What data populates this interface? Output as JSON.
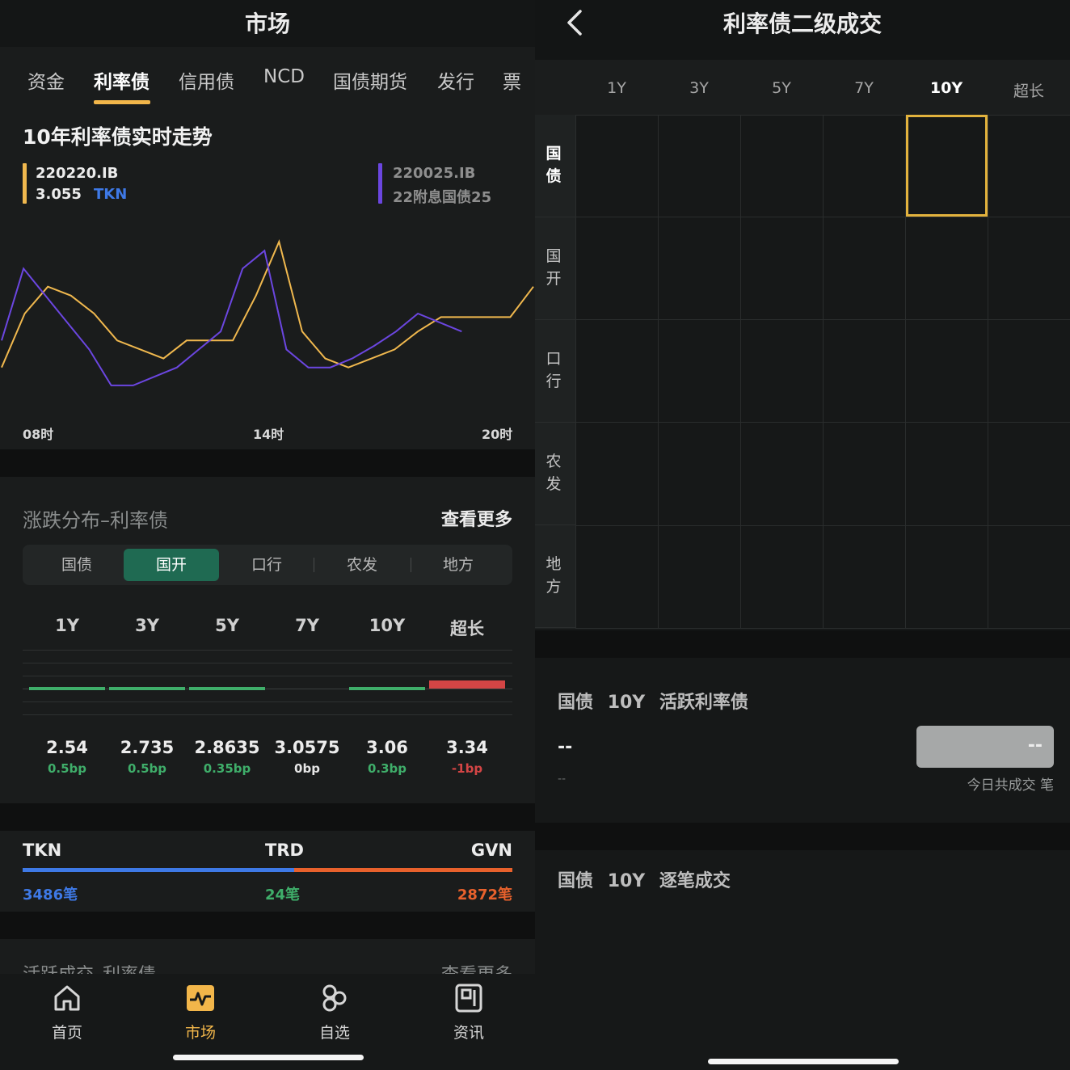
{
  "left": {
    "header_title": "市场",
    "tabs": [
      "资金",
      "利率债",
      "信用债",
      "NCD",
      "国债期货",
      "发行",
      "票"
    ],
    "chart": {
      "title": "10年利率债实时走势",
      "legend_a_code": "220220.IB",
      "legend_a_value": "3.055",
      "legend_a_source": "TKN",
      "legend_b_code": "220025.IB",
      "legend_b_name": "22附息国债25",
      "x_labels": [
        "08时",
        "14时",
        "20时"
      ]
    },
    "chart_data": {
      "type": "line",
      "title": "10年利率债实时走势",
      "x_ticks": [
        "08时",
        "14时",
        "20时"
      ],
      "series": [
        {
          "name": "220220.IB",
          "color": "#f0b84e",
          "values": [
            3.03,
            3.06,
            3.075,
            3.07,
            3.06,
            3.045,
            3.04,
            3.035,
            3.045,
            3.045,
            3.045,
            3.07,
            3.1,
            3.05,
            3.035,
            3.03,
            3.035,
            3.04,
            3.05,
            3.058,
            3.058,
            3.058,
            3.058,
            3.075
          ]
        },
        {
          "name": "220025.IB",
          "color": "#6b46e0",
          "values": [
            3.045,
            3.085,
            3.07,
            3.055,
            3.04,
            3.02,
            3.02,
            3.025,
            3.03,
            3.04,
            3.05,
            3.085,
            3.095,
            3.04,
            3.03,
            3.03,
            3.035,
            3.042,
            3.05,
            3.06,
            3.055,
            3.05
          ]
        }
      ]
    },
    "dist": {
      "title": "涨跌分布–利率债",
      "more": "查看更多",
      "segments": [
        "国债",
        "国开",
        "口行",
        "农发",
        "地方"
      ],
      "active_segment": "国开",
      "tenors": [
        "1Y",
        "3Y",
        "5Y",
        "7Y",
        "10Y",
        "超长"
      ],
      "yields": [
        "2.54",
        "2.735",
        "2.8635",
        "3.0575",
        "3.06",
        "3.34"
      ],
      "changes": [
        "0.5bp",
        "0.5bp",
        "0.35bp",
        "0bp",
        "0.3bp",
        "-1bp"
      ],
      "change_bp": [
        0.5,
        0.5,
        0.35,
        0,
        0.3,
        -1
      ],
      "up_color": "#3fae6a",
      "down_color": "#d44545"
    },
    "flow": {
      "tkn_label": "TKN",
      "trd_label": "TRD",
      "gvn_label": "GVN",
      "tkn_count": "3486笔",
      "trd_count": "24笔",
      "gvn_count": "2872笔",
      "tkn_color": "#3e79e6",
      "gvn_color": "#e8612c",
      "trd_color": "#3fae6a"
    },
    "peek": {
      "title": "活跃成交–利率债",
      "more": "查看更多"
    },
    "nav": [
      {
        "label": "首页",
        "icon": "home-icon"
      },
      {
        "label": "市场",
        "icon": "market-icon"
      },
      {
        "label": "自选",
        "icon": "favorites-icon"
      },
      {
        "label": "资讯",
        "icon": "news-icon"
      }
    ],
    "nav_active": "市场"
  },
  "right": {
    "header_title": "利率债二级成交",
    "tenors": [
      "1Y",
      "3Y",
      "5Y",
      "7Y",
      "10Y",
      "超长"
    ],
    "active_tenor": "10Y",
    "rows": [
      "国债",
      "国开",
      "口行",
      "农发",
      "地方"
    ],
    "active_row": "国债",
    "active_section": {
      "bond": "国债",
      "tenor": "10Y",
      "label": "活跃利率债"
    },
    "active_value": "--",
    "active_sub": "--",
    "pill_value": "--",
    "today_count": "今日共成交   笔",
    "trades_section": {
      "bond": "国债",
      "tenor": "10Y",
      "label": "逐笔成交"
    },
    "accent": "#e2b23d"
  }
}
